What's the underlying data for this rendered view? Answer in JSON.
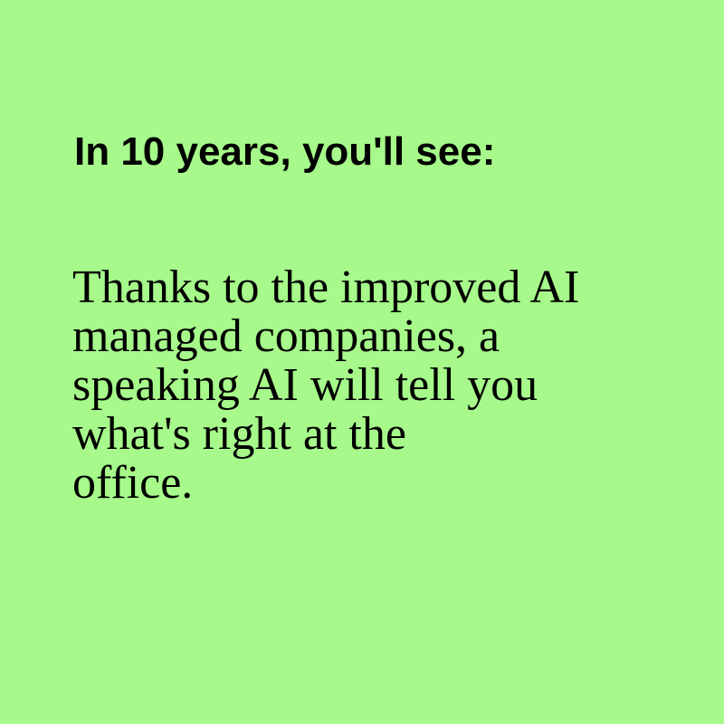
{
  "colors": {
    "background": "#a6f98a",
    "text": "#000000"
  },
  "heading": "In 10 years, you'll see:",
  "body_lines": [
    "Thanks to the improved AI",
    "managed companies, a",
    "speaking AI will tell you",
    "what's right at the",
    "office."
  ]
}
